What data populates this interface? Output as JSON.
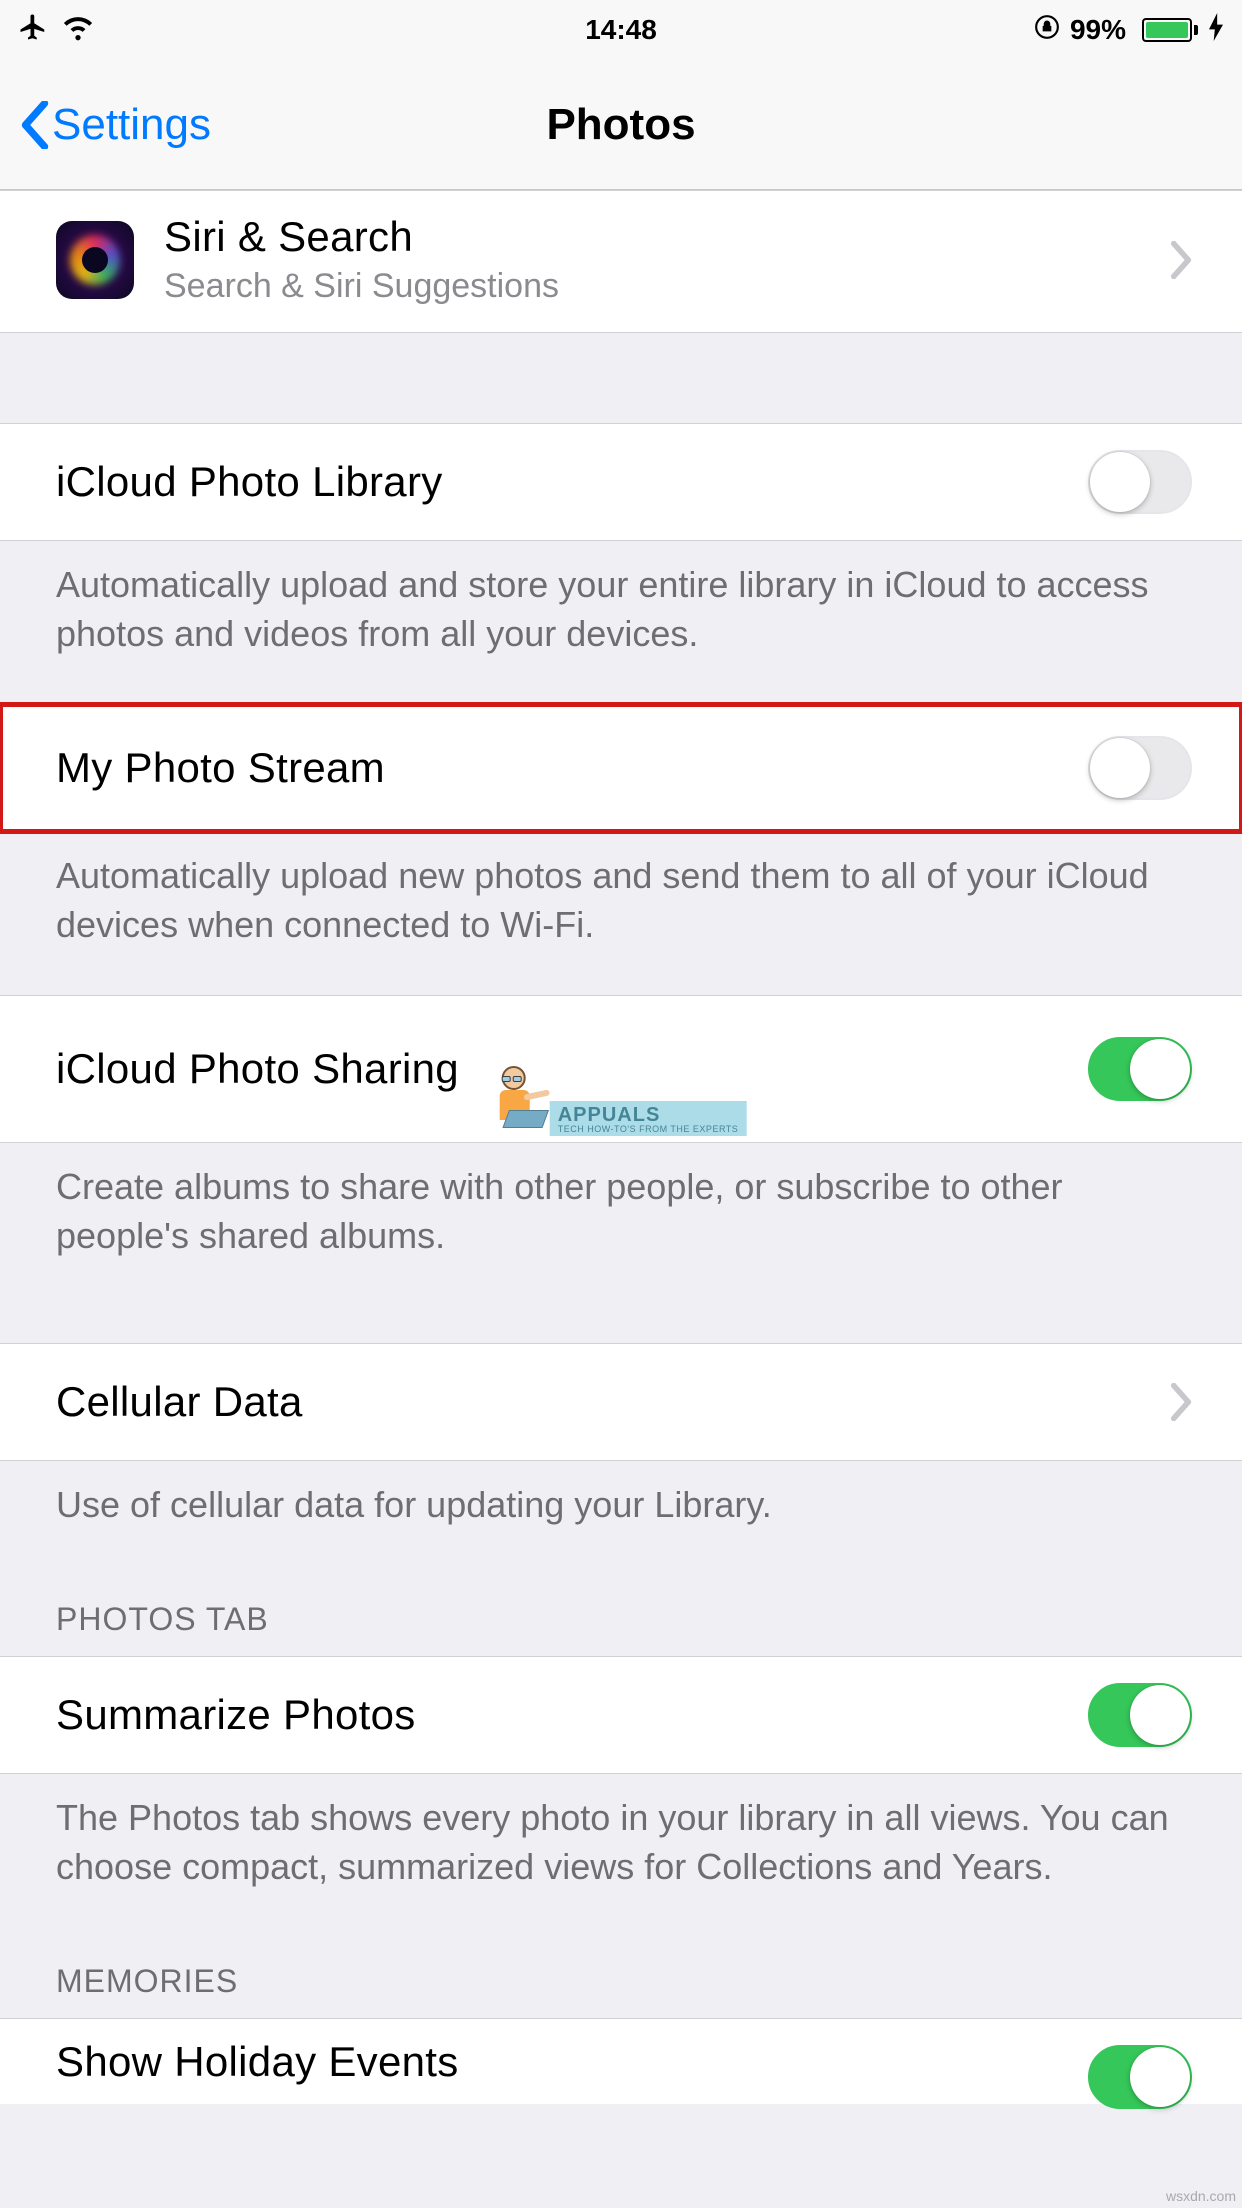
{
  "status": {
    "time": "14:48",
    "battery_pct": "99%"
  },
  "nav": {
    "back_label": "Settings",
    "title": "Photos"
  },
  "siri": {
    "title": "Siri & Search",
    "subtitle": "Search & Siri Suggestions"
  },
  "rows": {
    "icloud_library": {
      "label": "iCloud Photo Library",
      "on": false
    },
    "icloud_library_footer": "Automatically upload and store your entire library in iCloud to access photos and videos from all your devices.",
    "photo_stream": {
      "label": "My Photo Stream",
      "on": false
    },
    "photo_stream_footer": "Automatically upload new photos and send them to all of your iCloud devices when connected to Wi-Fi.",
    "photo_sharing": {
      "label": "iCloud Photo Sharing",
      "on": true
    },
    "photo_sharing_footer": "Create albums to share with other people, or subscribe to other people's shared albums.",
    "cellular": {
      "label": "Cellular Data"
    },
    "cellular_footer": "Use of cellular data for updating your Library.",
    "photos_tab_header": "PHOTOS TAB",
    "summarize": {
      "label": "Summarize Photos",
      "on": true
    },
    "summarize_footer": "The Photos tab shows every photo in your library in all views. You can choose compact, summarized views for Collections and Years.",
    "memories_header": "MEMORIES",
    "holiday": {
      "label": "Show Holiday Events",
      "on": true
    }
  },
  "watermark": {
    "brand": "Appuals",
    "tag": "TECH HOW-TO'S FROM THE EXPERTS"
  },
  "source_watermark": "wsxdn.com"
}
